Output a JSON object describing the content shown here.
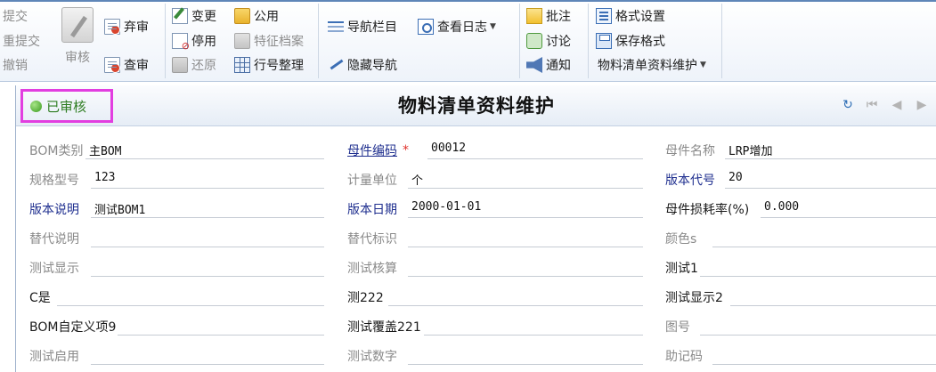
{
  "ribbon": {
    "group1": [
      "提交",
      "重提交",
      "撤销"
    ],
    "audit_label": "审核",
    "abandon_label": "弃审",
    "check_label": "查审",
    "change_label": "变更",
    "disable_label": "停用",
    "restore_label": "还原",
    "public_label": "公用",
    "feature_label": "特征档案",
    "rownum_label": "行号整理",
    "navbar_label": "导航栏目",
    "hidenav_label": "隐藏导航",
    "viewlog_label": "查看日志",
    "annotate_label": "批注",
    "discuss_label": "讨论",
    "notify_label": "通知",
    "formatset_label": "格式设置",
    "saveformat_label": "保存格式",
    "bom_maint_label": "物料清单资料维护"
  },
  "header": {
    "status": "已审核",
    "title": "物料清单资料维护"
  },
  "fields": {
    "bom_type": {
      "label": "BOM类别",
      "value": "主BOM"
    },
    "parent_code": {
      "label": "母件编码",
      "value": "00012"
    },
    "parent_name": {
      "label": "母件名称",
      "value": "LRP增加"
    },
    "spec": {
      "label": "规格型号",
      "value": "123"
    },
    "unit": {
      "label": "计量单位",
      "value": "个"
    },
    "version_code": {
      "label": "版本代号",
      "value": "20"
    },
    "version_desc": {
      "label": "版本说明",
      "value": "测试BOM1"
    },
    "version_date": {
      "label": "版本日期",
      "value": "2000-01-01"
    },
    "loss_rate": {
      "label": "母件损耗率(%)",
      "value": "0.000"
    },
    "replace_desc": {
      "label": "替代说明",
      "value": ""
    },
    "replace_flag": {
      "label": "替代标识",
      "value": ""
    },
    "color": {
      "label": "颜色s",
      "value": ""
    },
    "test_show": {
      "label": "测试显示",
      "value": ""
    },
    "test_check": {
      "label": "测试核算",
      "value": ""
    },
    "test1": {
      "label": "测试1",
      "value": ""
    },
    "c_yes": {
      "label": "C是",
      "value": ""
    },
    "ce222": {
      "label": "测222",
      "value": ""
    },
    "test_show2": {
      "label": "测试显示2",
      "value": ""
    },
    "bom_custom9": {
      "label": "BOM自定义项9",
      "value": ""
    },
    "test_cover221": {
      "label": "测试覆盖221",
      "value": ""
    },
    "drawing_no": {
      "label": "图号",
      "value": ""
    },
    "test_enable": {
      "label": "测试启用",
      "value": ""
    },
    "test_number": {
      "label": "测试数字",
      "value": ""
    },
    "mnemonic": {
      "label": "助记码",
      "value": ""
    }
  }
}
